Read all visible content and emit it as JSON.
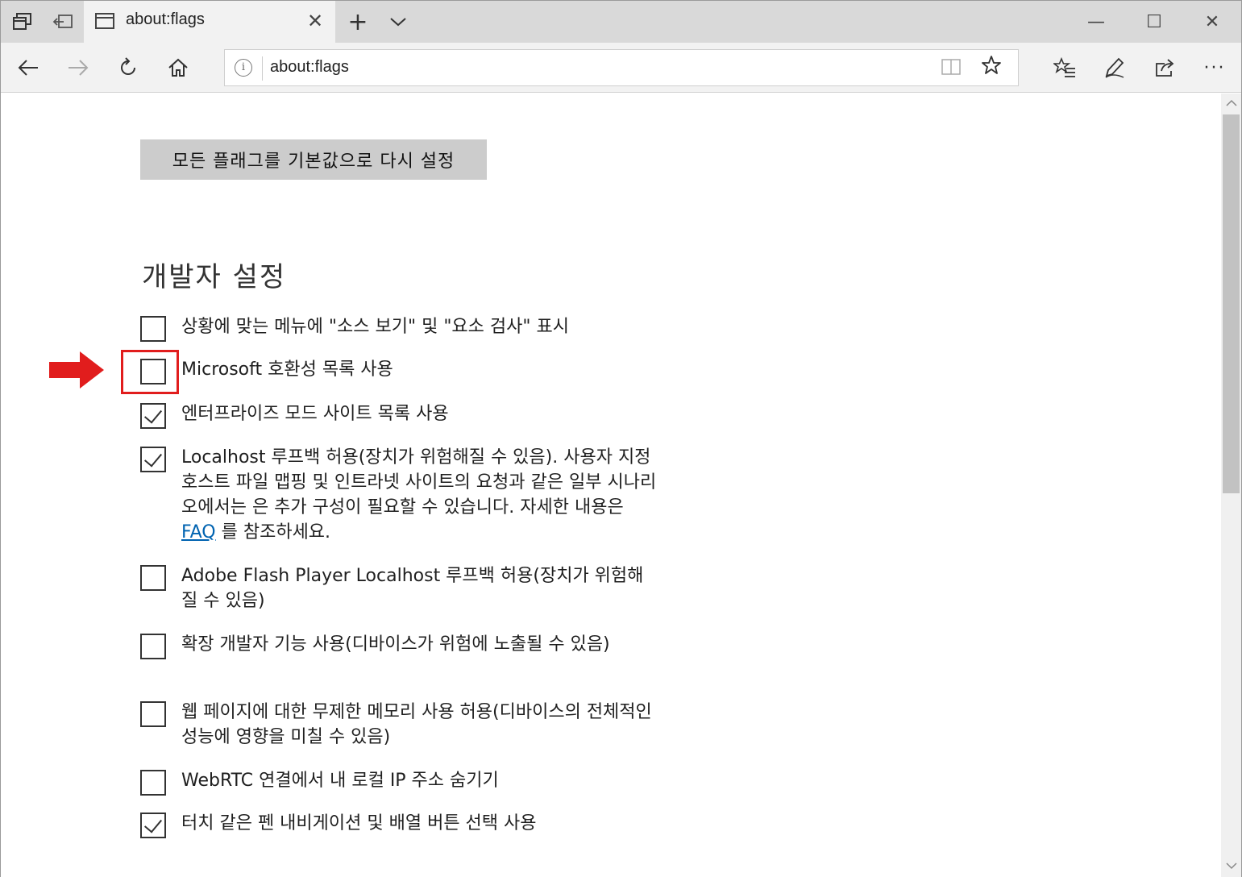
{
  "browser": {
    "tab": {
      "title": "about:flags",
      "close_glyph": "✕"
    },
    "new_tab_glyph": "+",
    "tab_list_glyph": "⌄",
    "window_controls": {
      "minimize": "—",
      "maximize": "☐",
      "close": "✕"
    },
    "address": {
      "url": "about:flags",
      "info_glyph": "i"
    },
    "toolbar": {
      "more_glyph": "···"
    }
  },
  "page": {
    "reset_button_label": "모든 플래그를 기본값으로 다시 설정",
    "section_title": "개발자 설정",
    "flags": [
      {
        "label": "상황에 맞는 메뉴에 \"소스 보기\" 및 \"요소 검사\" 표시",
        "checked": false
      },
      {
        "label": "Microsoft 호환성 목록 사용",
        "checked": false,
        "highlighted": true
      },
      {
        "label": "엔터프라이즈 모드 사이트 목록 사용",
        "checked": true
      },
      {
        "label_before": "Localhost 루프백 허용(장치가 위험해질 수 있음). 사용자 지정 호스트 파일 맵핑 및 인트라넷 사이트의 요청과 같은 일부 시나리오에서는 은 추가 구성이 필요할 수 있습니다. 자세한 내용은 ",
        "link": "FAQ",
        "label_after": " 를 참조하세요.",
        "checked": true
      },
      {
        "label": "Adobe Flash Player Localhost 루프백 허용(장치가 위험해질 수 있음)",
        "checked": false
      },
      {
        "label": "확장 개발자 기능 사용(디바이스가 위험에 노출될 수 있음)",
        "checked": false
      },
      {
        "label": "웹 페이지에 대한 무제한 메모리 사용 허용(디바이스의 전체적인 성능에 영향을 미칠 수 있음)",
        "checked": false
      },
      {
        "label": "WebRTC 연결에서 내 로컬 IP 주소 숨기기",
        "checked": false
      },
      {
        "label": "터치 같은 펜 내비게이션 및 배열 버튼 선택 사용",
        "checked": true
      }
    ]
  },
  "annotation": {
    "arrow_color": "#e11d1d",
    "box_color": "#e11d1d"
  }
}
